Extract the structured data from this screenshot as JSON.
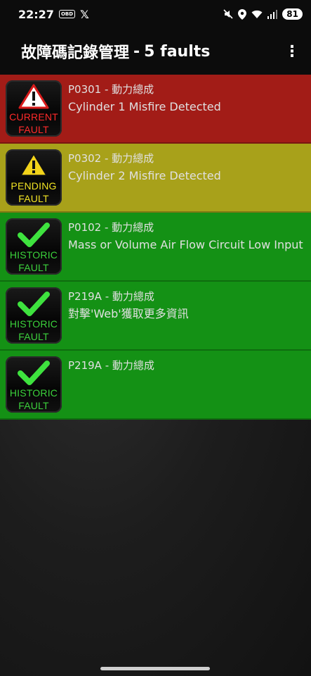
{
  "status": {
    "time": "22:27",
    "obd": "OBD",
    "x": "𝕏",
    "battery": "81"
  },
  "appbar": {
    "title": "故障碼記錄管理",
    "sep": "-",
    "count": "5 faults"
  },
  "faults": [
    {
      "badge_line1": "CURRENT",
      "badge_line2": "FAULT",
      "code": "P0301 - 動力總成",
      "desc": "Cylinder 1 Misfire Detected"
    },
    {
      "badge_line1": "PENDING",
      "badge_line2": "FAULT",
      "code": "P0302 - 動力總成",
      "desc": "Cylinder 2 Misfire Detected"
    },
    {
      "badge_line1": "HISTORIC",
      "badge_line2": "FAULT",
      "code": "P0102 - 動力總成",
      "desc": "Mass or Volume Air Flow Circuit Low Input"
    },
    {
      "badge_line1": "HISTORIC",
      "badge_line2": "FAULT",
      "code": "P219A - 動力總成",
      "desc": "對擊'Web'獲取更多資訊"
    },
    {
      "badge_line1": "HISTORIC",
      "badge_line2": "FAULT",
      "code": "P219A - 動力總成",
      "desc": ""
    }
  ],
  "colors": {
    "current": "#a21c17",
    "pending": "#a8a11a",
    "historic": "#149115"
  },
  "icons": {
    "warning_red": "warning-triangle-icon",
    "warning_yellow": "warning-triangle-icon",
    "check": "checkmark-icon"
  }
}
